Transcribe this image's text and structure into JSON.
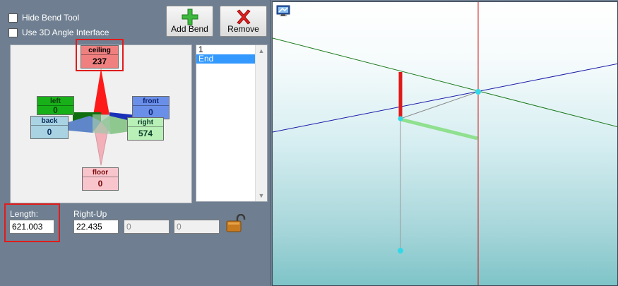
{
  "checkboxes": {
    "hide_bend_tool": "Hide Bend Tool",
    "use_3d_angle": "Use 3D Angle Interface"
  },
  "toolbar": {
    "add_bend_label": "Add Bend",
    "remove_label": "Remove"
  },
  "directions": {
    "ceiling": {
      "name": "ceiling",
      "value": "237"
    },
    "left": {
      "name": "left",
      "value": "0"
    },
    "front": {
      "name": "front",
      "value": "0"
    },
    "back": {
      "name": "back",
      "value": "0"
    },
    "right": {
      "name": "right",
      "value": "574"
    },
    "floor": {
      "name": "floor",
      "value": "0"
    }
  },
  "bend_list": {
    "items": [
      "1",
      "End"
    ],
    "selected": "End"
  },
  "length": {
    "label": "Length:",
    "value": "621.003"
  },
  "angles": {
    "label": "Right-Up",
    "value1": "22.435",
    "value2": "0",
    "value3": "0"
  },
  "colors": {
    "panel_bg": "#6f7f91",
    "ceiling": "#f08080",
    "left": "#18b018",
    "front": "#6a8fe8",
    "back": "#a9d3e3",
    "right": "#b8f0b8",
    "floor": "#f9c5cc",
    "highlight": "#e01c1c",
    "selection": "#3399ff"
  }
}
